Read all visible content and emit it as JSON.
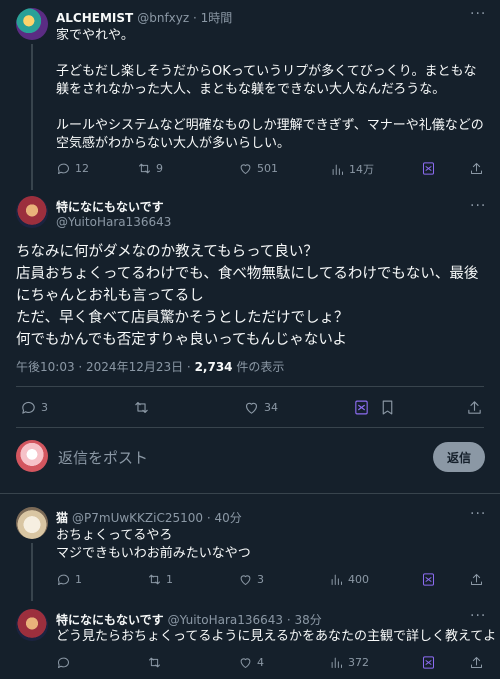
{
  "tweet1": {
    "name": "ALCHEMIST",
    "handle": "@bnfxyz · 1時間",
    "text": "家でやれや。\n\n子どもだし楽しそうだからOKっていうリプが多くてびっくり。まともな躾をされなかった大人、まともな躾をできない大人なんだろうな。\n\nルールやシステムなど明確なものしか理解できぎず、マナーや礼儀などの空気感がわからない大人が多いらしい。",
    "replies": "12",
    "retweets": "9",
    "likes": "501",
    "views": "14万"
  },
  "main": {
    "name": "特になにもないです",
    "handle": "@YuitoHara136643",
    "text": "ちなみに何がダメなのか教えてもらって良い？\n店員おちょくってるわけでも、食べ物無駄にしてるわけでもない、最後にちゃんとお礼も言ってるし\nただ、早く食べて店員驚かそうとしただけでしょ？\n何でもかんでも否定すりゃ良いってもんじゃないよ",
    "time": "午後10:03 · 2024年12月23日 · ",
    "views_count": "2,734",
    "views_label": " 件の表示",
    "replies": "3",
    "likes": "34"
  },
  "composer": {
    "placeholder": "返信をポスト",
    "button": "返信"
  },
  "reply1": {
    "name": "猫",
    "handle": "@P7mUwKKZiC25100 · 40分",
    "text": "おちょくってるやろ\nマジできもいわお前みたいなやつ",
    "replies": "1",
    "retweets": "1",
    "likes": "3",
    "views": "400"
  },
  "reply2": {
    "name": "特になにもないです",
    "handle": "@YuitoHara136643 · 38分",
    "text": "どう見たらおちょくってるように見えるかをあなたの主観で詳しく教えてよ",
    "likes": "4",
    "views": "372"
  },
  "icons": {
    "reply": "speech-bubble-icon",
    "retweet": "retweet-icon",
    "like": "heart-icon",
    "views": "bar-chart-icon",
    "grok": "grok-icon",
    "bookmark": "bookmark-icon",
    "share": "share-icon",
    "more": "more-icon"
  },
  "colors": {
    "background": "#15202b",
    "text": "#f7f9f9",
    "muted": "#8b98a5",
    "divider": "#38444d",
    "accent_purple": "#8c6cf2"
  }
}
